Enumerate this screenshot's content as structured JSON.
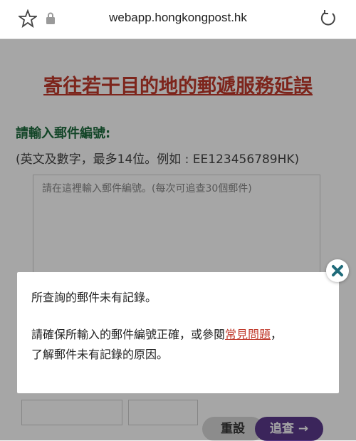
{
  "browser": {
    "url": "webapp.hongkongpost.hk"
  },
  "page": {
    "title": "寄往若干目的地的郵遞服務延誤",
    "label": "請輸入郵件編號:",
    "hint": "(英文及數字，最多14位。例如 : EE123456789HK)",
    "textarea_placeholder": "請在這裡輸入郵件編號。(每次可追查30個郵件)",
    "reset_button": "重設",
    "track_button": "追查 →"
  },
  "modal": {
    "line1": "所查詢的郵件未有記錄。",
    "line2_before": "請確保所輸入的郵件編號正確，或參閱",
    "faq_link": "常見問題",
    "line2_after": "，",
    "line3": "了解郵件未有記錄的原因。"
  },
  "colors": {
    "title": "#c0392b",
    "label": "#1d6b3d",
    "track_button": "#5b3a8c",
    "close_icon": "#1f6b7a"
  }
}
